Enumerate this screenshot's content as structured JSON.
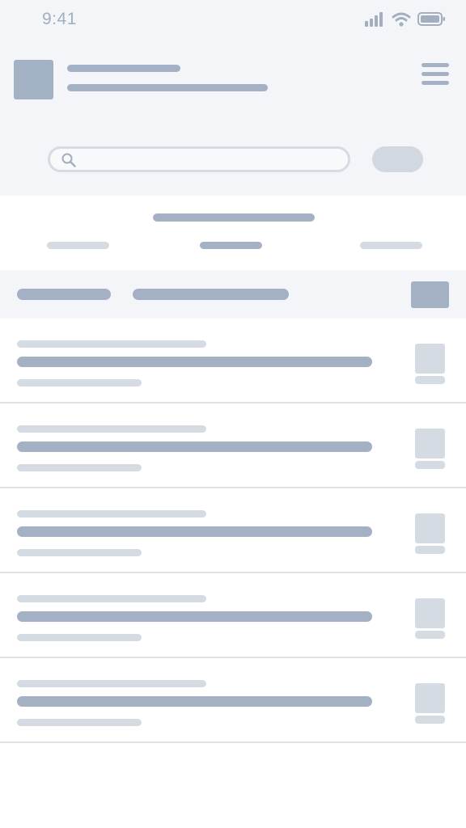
{
  "status_bar": {
    "time": "9:41",
    "icons": [
      "signal-icon",
      "wifi-icon",
      "battery-icon"
    ]
  },
  "header": {
    "icons": [
      "logo-placeholder",
      "menu-icon"
    ]
  },
  "search": {
    "placeholder": "",
    "icon": "search-icon"
  },
  "list": {
    "row_count": 5
  },
  "colors": {
    "background_top": "#f3f5f9",
    "placeholder_dark": "#a4b1c4",
    "placeholder_light": "#d4dbe3",
    "divider": "#dde2e8",
    "white": "#ffffff"
  }
}
